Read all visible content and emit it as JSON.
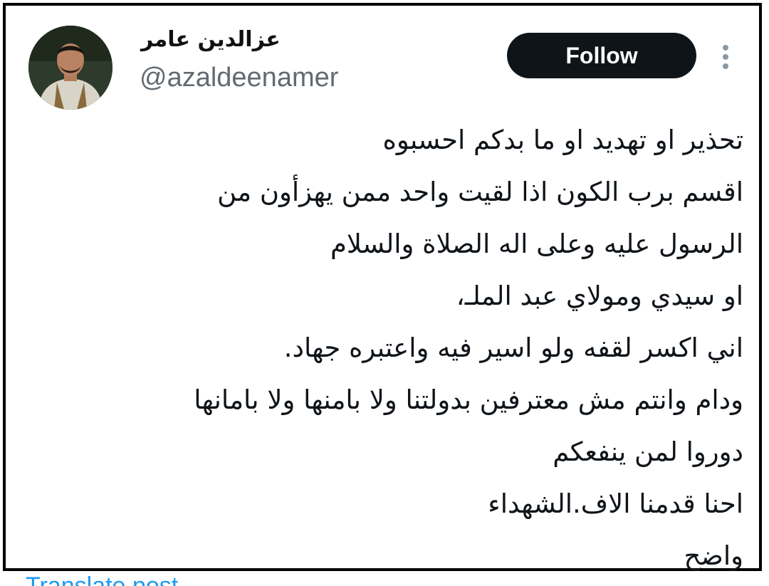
{
  "profile": {
    "display_name": "عزالدين عامر",
    "handle": "@azaldeenamer"
  },
  "follow_button": {
    "label": "Follow"
  },
  "more_menu": {
    "icon": "vertical-dots-icon"
  },
  "tweet": {
    "lines": [
      "تحذير او تهديد او ما بدكم احسبوه",
      "اقسم برب الكون اذا لقيت واحد ممن يهزأون من",
      "الرسول عليه وعلى اله الصلاة والسلام",
      "او سيدي ومولاي عبد الملـ،",
      "اني اكسر لقفه ولو اسير فيه واعتبره جهاد.",
      "ودام وانتم مش معترفين بدولتنا ولا بامنها ولا بامانها",
      "دوروا لمن ينفعكم",
      "احنا قدمنا الاف.الشهداء",
      "واضح"
    ]
  },
  "translate": {
    "label": "Translate post"
  },
  "colors": {
    "follow_bg": "#0f1419",
    "handle": "#626a71",
    "link": "#1d9bf0",
    "frame": "#000000"
  }
}
